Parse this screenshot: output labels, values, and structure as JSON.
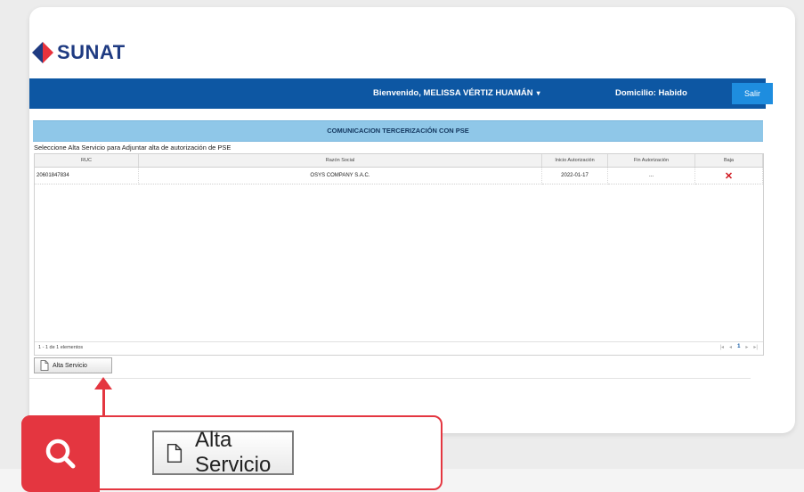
{
  "brand": {
    "name": "SUNAT"
  },
  "topbar": {
    "welcome": "Bienvenido, MELISSA VÉRTIZ HUAMÁN",
    "caret": "▾",
    "domicilio": "Domicilio: Habido",
    "logout_label": "Salir"
  },
  "section": {
    "title": "COMUNICACION TERCERIZACIÓN CON PSE",
    "instruction": "Seleccione Alta Servicio para Adjuntar alta de autorización de PSE"
  },
  "table": {
    "columns": [
      "RUC",
      "Razón Social",
      "Inicio Autorización",
      "Fin Autorización",
      "Baja"
    ],
    "rows": [
      {
        "ruc": "20601847834",
        "razon_social": "OSYS COMPANY S.A.C.",
        "inicio": "2022-01-17",
        "fin": "...",
        "baja_icon": "delete-x-icon"
      }
    ],
    "footer_count": "1 - 1 de 1 elementos",
    "pager": {
      "first": "|◂",
      "prev": "◂",
      "current": "1",
      "next": "▸",
      "last": "▸|"
    }
  },
  "actions": {
    "alta_servicio_label": "Alta Servicio"
  },
  "callout": {
    "button_label": "Alta Servicio",
    "icon": "search-icon"
  },
  "colors": {
    "topbar": "#0d57a3",
    "section_header": "#8fc7e8",
    "callout_red": "#e43640",
    "delete_red": "#d0161e"
  }
}
